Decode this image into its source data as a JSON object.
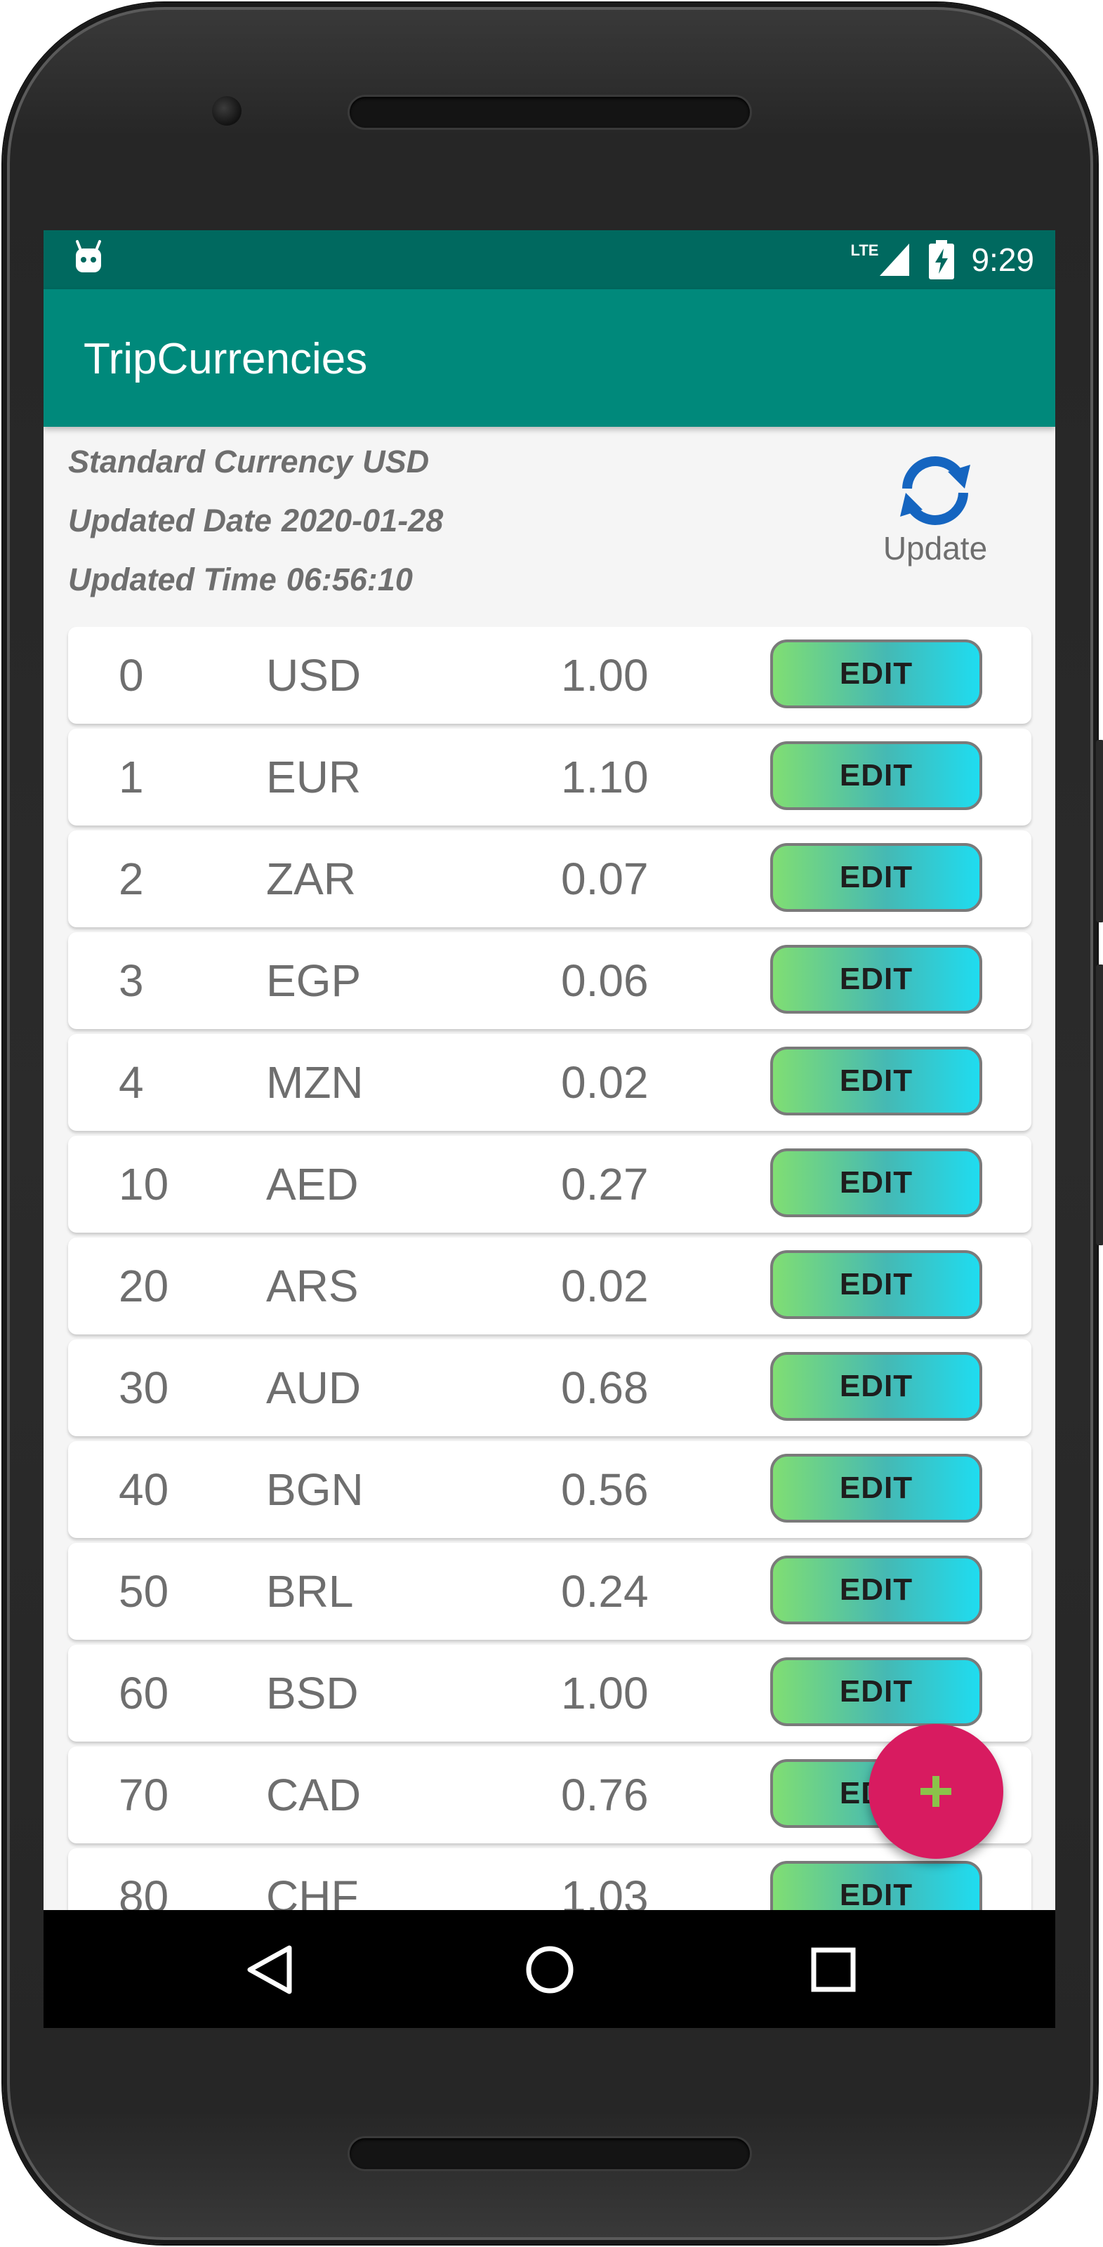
{
  "status_bar": {
    "network": "LTE",
    "time": "9:29"
  },
  "app_bar": {
    "title": "TripCurrencies"
  },
  "info": {
    "standard_currency_label": "Standard Currency",
    "standard_currency_value": "USD",
    "updated_date_label": "Updated Date",
    "updated_date_value": "2020-01-28",
    "updated_time_label": "Updated Time",
    "updated_time_value": "06:56:10"
  },
  "update_button": {
    "label": "Update",
    "icon": "refresh-icon",
    "color": "#1565c0"
  },
  "currency_rows": [
    {
      "id": "0",
      "code": "USD",
      "rate": "1.00",
      "action": "EDIT"
    },
    {
      "id": "1",
      "code": "EUR",
      "rate": "1.10",
      "action": "EDIT"
    },
    {
      "id": "2",
      "code": "ZAR",
      "rate": "0.07",
      "action": "EDIT"
    },
    {
      "id": "3",
      "code": "EGP",
      "rate": "0.06",
      "action": "EDIT"
    },
    {
      "id": "4",
      "code": "MZN",
      "rate": "0.02",
      "action": "EDIT"
    },
    {
      "id": "10",
      "code": "AED",
      "rate": "0.27",
      "action": "EDIT"
    },
    {
      "id": "20",
      "code": "ARS",
      "rate": "0.02",
      "action": "EDIT"
    },
    {
      "id": "30",
      "code": "AUD",
      "rate": "0.68",
      "action": "EDIT"
    },
    {
      "id": "40",
      "code": "BGN",
      "rate": "0.56",
      "action": "EDIT"
    },
    {
      "id": "50",
      "code": "BRL",
      "rate": "0.24",
      "action": "EDIT"
    },
    {
      "id": "60",
      "code": "BSD",
      "rate": "1.00",
      "action": "EDIT"
    },
    {
      "id": "70",
      "code": "CAD",
      "rate": "0.76",
      "action": "EDIT"
    },
    {
      "id": "80",
      "code": "CHF",
      "rate": "1.03",
      "action": "EDIT"
    }
  ],
  "fab": {
    "icon": "plus-icon",
    "color": "#d81b60",
    "icon_color": "#8bc34a"
  },
  "nav_bar": {
    "icons": [
      "back-icon",
      "home-icon",
      "recents-icon"
    ]
  },
  "colors": {
    "status_bar": "#00695f",
    "app_bar": "#00897b"
  }
}
